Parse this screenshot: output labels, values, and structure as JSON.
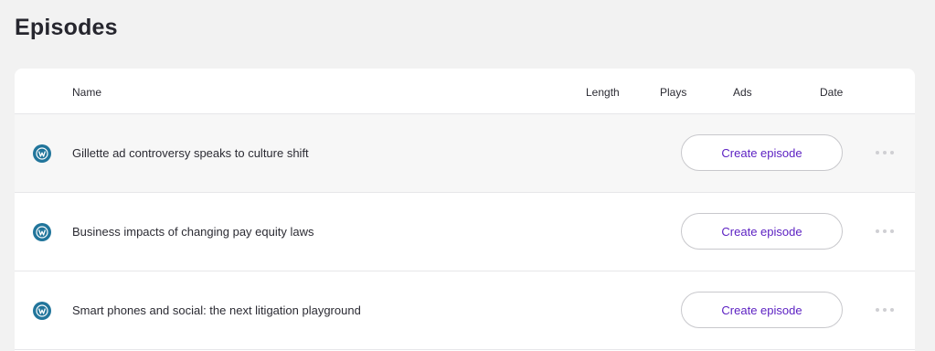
{
  "page": {
    "title": "Episodes"
  },
  "table": {
    "columns": {
      "name": "Name",
      "length": "Length",
      "plays": "Plays",
      "ads": "Ads",
      "date": "Date"
    },
    "rows": [
      {
        "icon": "wordpress-icon",
        "title": "Gillette ad controversy speaks to culture shift",
        "action": "Create episode"
      },
      {
        "icon": "wordpress-icon",
        "title": "Business impacts of changing pay equity laws",
        "action": "Create episode"
      },
      {
        "icon": "wordpress-icon",
        "title": "Smart phones and social: the next litigation playground",
        "action": "Create episode"
      }
    ]
  },
  "colors": {
    "background": "#f2f2f2",
    "wordpress_blue": "#21759b",
    "action_text": "#5b1fc2"
  }
}
